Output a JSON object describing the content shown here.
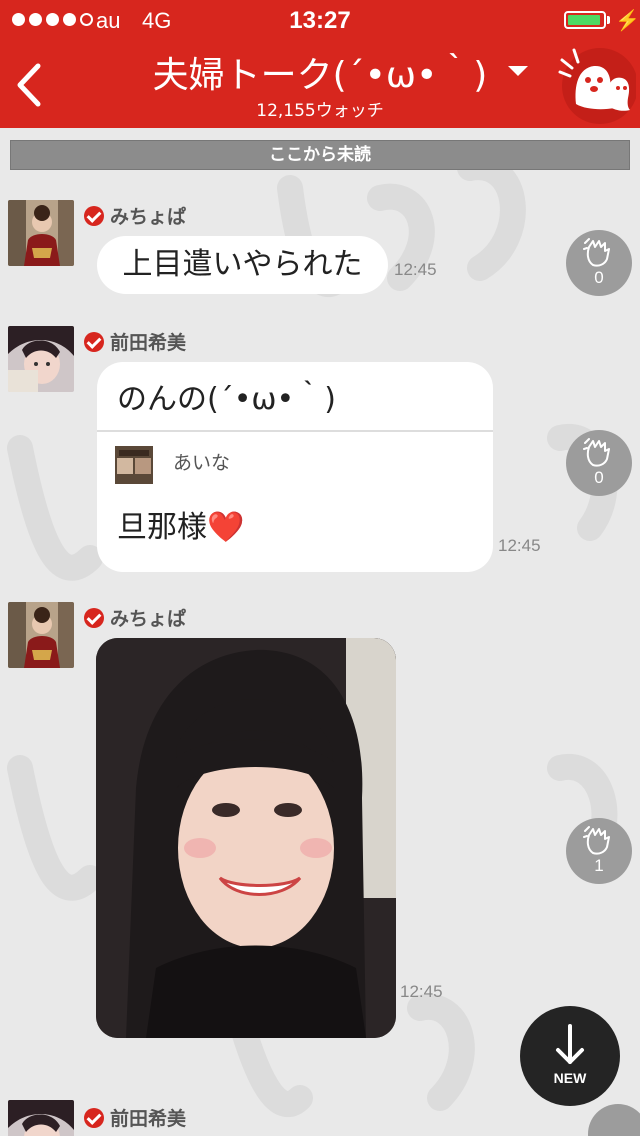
{
  "status_bar": {
    "signal_dots_filled": 4,
    "signal_dots_total": 5,
    "carrier": "au",
    "network": "4G",
    "time": "13:27",
    "battery_level": 0.95,
    "charging_glyph": "⚡"
  },
  "header": {
    "title": "夫婦トーク(´•ω•｀)",
    "subtitle": "12,155ウォッチ",
    "back_icon": "chevron-left-icon",
    "dropdown_icon": "caret-down-icon",
    "mascot_icon": "ghost-mascot-icon",
    "background_color": "#d7261e"
  },
  "unread_divider": "ここから未読",
  "messages": [
    {
      "sender": "みちょぱ",
      "verified": true,
      "text": "上目遣いやられた",
      "time": "12:45",
      "claps": "0"
    },
    {
      "sender": "前田希美",
      "verified": true,
      "text": "のんの(´•ω•｀)",
      "quote": {
        "sender": "あいな",
        "text": "旦那様❤️"
      },
      "time": "12:45",
      "claps": "0"
    },
    {
      "sender": "みちょぱ",
      "verified": true,
      "image": "selfie-photo",
      "time": "12:45",
      "claps": "1"
    },
    {
      "sender": "前田希美",
      "verified": true
    }
  ],
  "new_button": {
    "label": "NEW",
    "icon": "arrow-down-icon"
  },
  "colors": {
    "accent": "#d7261e",
    "chat_background": "#e9e9e9",
    "clap_button": "#9c9c9c",
    "new_button": "#242424"
  }
}
